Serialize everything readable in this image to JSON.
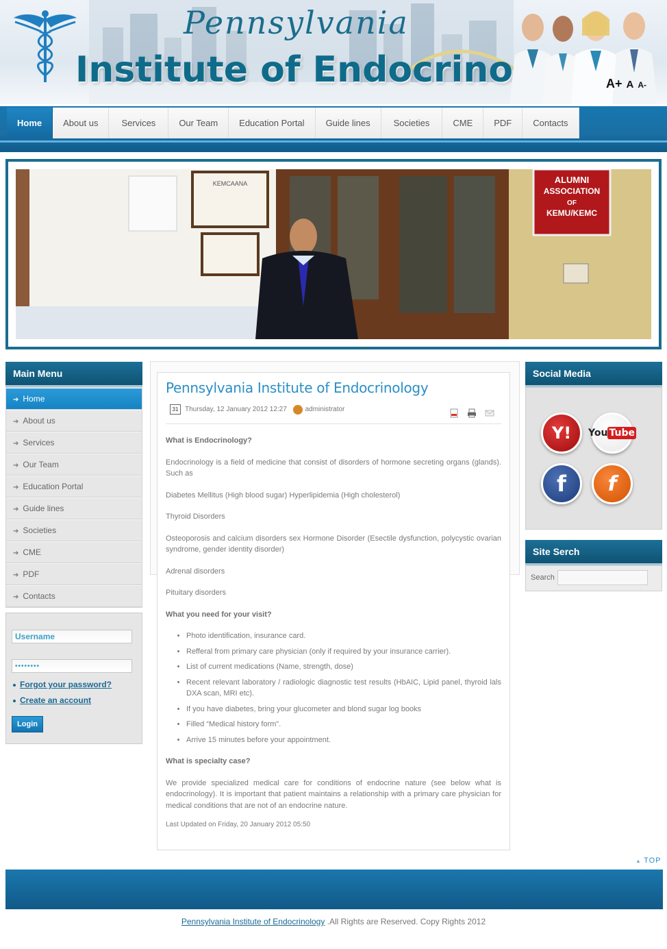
{
  "header": {
    "subtitle": "Pennsylvania",
    "title": "Institute of Endocrinology",
    "font_tools": [
      "A+",
      "A",
      "A-"
    ]
  },
  "nav": {
    "items": [
      "Home",
      "About us",
      "Services",
      "Our Team",
      "Education Portal",
      "Guide lines",
      "Societies",
      "CME",
      "PDF",
      "Contacts"
    ],
    "active": "Home"
  },
  "banner": {
    "plaque_text": "KEMCAANA",
    "sign_lines": [
      "ALUMNI",
      "ASSOCIATION",
      "OF",
      "KEMU/KEMC"
    ]
  },
  "main_menu": {
    "title": "Main Menu",
    "items": [
      "Home",
      "About us",
      "Services",
      "Our Team",
      "Education Portal",
      "Guide lines",
      "Societies",
      "CME",
      "PDF",
      "Contacts"
    ]
  },
  "login": {
    "username_value": "Username",
    "password_value": "••••••••",
    "forgot": "Forgot your password?",
    "create": "Create an account",
    "button": "Login"
  },
  "article": {
    "title": "Pennsylvania Institute of Endocrinology",
    "cal_day": "31",
    "date": "Thursday, 12 January 2012 12:27",
    "author": "administrator",
    "h_what": "What is Endocrinology?",
    "p1": "Endocrinology is a field of medicine that consist of disorders of hormone secreting organs (glands). Such as",
    "p2": "Diabetes Mellitus (High blood sugar) Hyperlipidemia (High cholesterol)",
    "p3": "Thyroid Disorders",
    "p4": "Osteoporosis and calcium disorders sex Hormone Disorder (Esectile dysfunction, polycystic ovarian syndrome, gender identity disorder)",
    "p5": "Adrenal disorders",
    "p6": "Pituitary disorders",
    "h_need": "What you need for your visit?",
    "list": [
      "Photo identification, insurance card.",
      "Refferal from primary care physician (only if required by your insurance carrier).",
      "List of current medications (Name, strength, dose)",
      "Recent relevant laboratory / radiologic diagnostic test results (HbAIC, Lipid panel, thyroid lals DXA scan, MRI etc).",
      "If you have diabetes, bring your glucometer and blond sugar log books",
      "Filled “Medical history form”.",
      "Arrive 15 minutes before your appointment."
    ],
    "h_special": "What is specialty case?",
    "p7": "We provide specialized medical care for conditions of endocrine nature (see below what is endocrinology). It is important that patient maintains a relationship with a primary care physician for medical conditions that are not of an endocrine nature.",
    "updated": "Last Updated on Friday, 20 January 2012 05:50"
  },
  "social": {
    "title": "Social Media",
    "icons": [
      "yahoo-icon",
      "youtube-icon",
      "facebook-icon",
      "friendfeed-icon"
    ]
  },
  "search": {
    "title": "Site Serch",
    "label": "Search"
  },
  "footer": {
    "top": "TOP",
    "site_link": "Pennsylvania Institute of Endocrinology",
    "rights": " .All Rights are Reserved. Copy Rights 2012"
  },
  "colors": {
    "brand_blue": "#1a6d90",
    "nav_active": "#1f86c4",
    "link": "#2b8fc4"
  }
}
